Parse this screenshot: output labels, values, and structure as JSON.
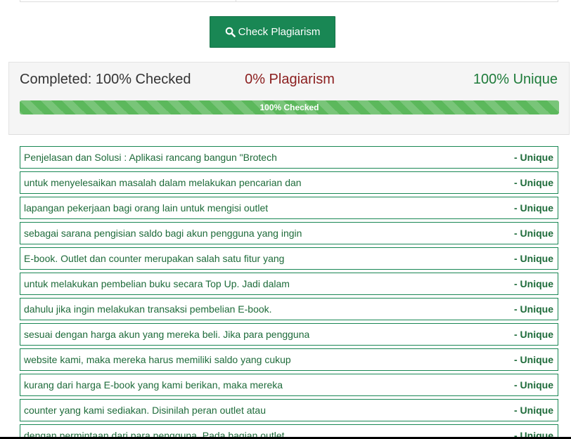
{
  "action": {
    "check_button_label": "Check Plagiarism",
    "icon": "search-icon"
  },
  "result": {
    "completed_text": "Completed: 100% Checked",
    "plagiarism_text": "0% Plagiarism",
    "unique_text": "100% Unique",
    "progress_label": "100% Checked",
    "progress_percent": 100
  },
  "colors": {
    "button": "#198754",
    "plagiarism": "#8b1e1e",
    "unique": "#1e7b3a",
    "progress": "#5cb85c"
  },
  "sentences": [
    {
      "text": "Penjelasan dan Solusi : Aplikasi rancang bangun \"Brotech",
      "status": "- Unique"
    },
    {
      "text": "untuk menyelesaikan masalah dalam melakukan pencarian dan",
      "status": "- Unique"
    },
    {
      "text": "lapangan pekerjaan bagi orang lain untuk mengisi outlet",
      "status": "- Unique"
    },
    {
      "text": "sebagai sarana pengisian saldo bagi akun pengguna yang ingin",
      "status": "- Unique"
    },
    {
      "text": "E-book. Outlet dan counter merupakan salah satu fitur yang",
      "status": "- Unique"
    },
    {
      "text": "untuk melakukan pembelian buku secara Top Up. Jadi dalam",
      "status": "- Unique"
    },
    {
      "text": "dahulu jika ingin melakukan transaksi pembelian E-book.",
      "status": "- Unique"
    },
    {
      "text": "sesuai dengan harga akun yang mereka beli. Jika para pengguna",
      "status": "- Unique"
    },
    {
      "text": "website kami, maka mereka harus memiliki saldo yang cukup",
      "status": "- Unique"
    },
    {
      "text": "kurang dari harga E-book yang kami berikan, maka mereka",
      "status": "- Unique"
    },
    {
      "text": "counter yang kami sediakan. Disinilah peran outlet atau",
      "status": "- Unique"
    },
    {
      "text": "dengan permintaan dari para pengguna. Pada bagian outlet",
      "status": "- Unique"
    }
  ]
}
